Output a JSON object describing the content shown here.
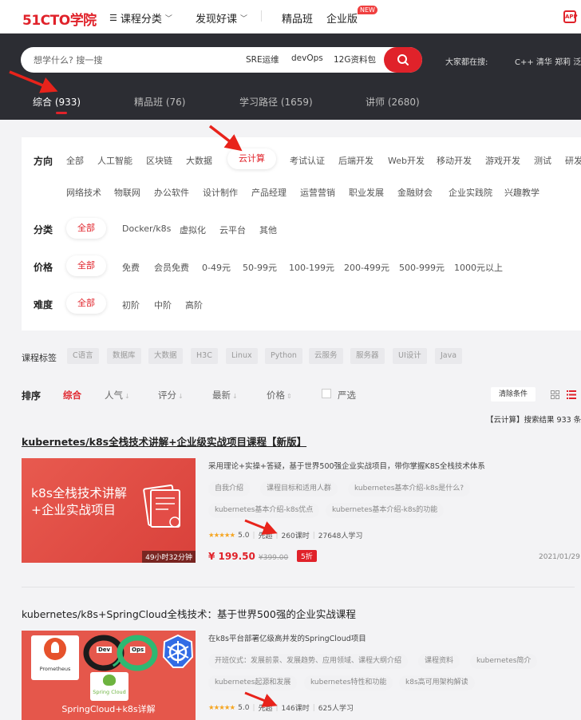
{
  "topnav": {
    "logo_main": "51CTO",
    "logo_suffix": "学院",
    "items": [
      {
        "label": "课程分类"
      },
      {
        "label": "发现好课"
      },
      {
        "label": "精品班"
      },
      {
        "label": "企业版"
      }
    ],
    "new_badge": "NEW",
    "app_icon_text": "APP"
  },
  "search": {
    "placeholder": "想学什么? 搜一搜",
    "hot_keywords": [
      "SRE运维",
      "devOps",
      "12G资料包"
    ],
    "right_label": "大家都在搜:",
    "right_terms": "C++ 清华 郑莉 泛"
  },
  "tabs": [
    {
      "label": "综合 (933)",
      "active": true
    },
    {
      "label": "精品班 (76)",
      "active": false
    },
    {
      "label": "学习路径 (1659)",
      "active": false
    },
    {
      "label": "讲师 (2680)",
      "active": false
    }
  ],
  "filters": {
    "direction": {
      "label": "方向",
      "row1": [
        "全部",
        "人工智能",
        "区块链",
        "大数据",
        "云计算",
        "考试认证",
        "后端开发",
        "Web开发",
        "移动开发",
        "游戏开发",
        "测试",
        "研发"
      ],
      "row2": [
        "网络技术",
        "物联网",
        "办公软件",
        "设计制作",
        "产品经理",
        "运营营销",
        "职业发展",
        "金融财会",
        "企业实践院",
        "兴趣教学"
      ],
      "selected": "云计算"
    },
    "category": {
      "label": "分类",
      "options": [
        "全部",
        "Docker/k8s",
        "虚拟化",
        "云平台",
        "其他"
      ],
      "selected": "全部"
    },
    "price": {
      "label": "价格",
      "options": [
        "全部",
        "免费",
        "会员免费",
        "0-49元",
        "50-99元",
        "100-199元",
        "200-499元",
        "500-999元",
        "1000元以上"
      ],
      "selected": "全部"
    },
    "level": {
      "label": "难度",
      "options": [
        "全部",
        "初阶",
        "中阶",
        "高阶"
      ],
      "selected": "全部"
    }
  },
  "course_tags": {
    "label": "课程标签",
    "tags": [
      "C语言",
      "数据库",
      "大数据",
      "H3C",
      "Linux",
      "Python",
      "云服务",
      "服务器",
      "UI设计",
      "Java"
    ]
  },
  "sort": {
    "label": "排序",
    "options": [
      "综合",
      "人气",
      "评分",
      "最新",
      "价格"
    ],
    "active": "综合",
    "strict_label": "严选",
    "clear_label": "清除条件"
  },
  "result_summary": "【云计算】搜索结果 933 条",
  "courses": [
    {
      "title": "kubernetes/k8s全栈技术讲解+企业级实战项目课程【新版】",
      "thumb_text": "k8s全栈技术讲解+企业实战项目",
      "duration": "49小时32分钟",
      "description": "采用理论+实操+答疑，基于世界500强企业实战项目，带你掌握K8S全栈技术体系",
      "chapters": [
        "自我介绍",
        "课程目标和适用人群",
        "kubernetes基本介绍-k8s是什么?",
        "kubernetes基本介绍-k8s优点",
        "kubernetes基本介绍-k8s的功能"
      ],
      "rating": "5.0",
      "level": "先超",
      "lessons": "260课时",
      "students": "27648人学习",
      "price": "¥ 199.50",
      "old_price": "¥399.00",
      "discount": "5折",
      "date": "2021/01/29"
    },
    {
      "title": "kubernetes/k8s+SpringCloud全栈技术：基于世界500强的企业实战课程",
      "thumb_labels": [
        "Prometheus",
        "Dev",
        "Ops",
        "Spring Cloud"
      ],
      "thumb_caption": "SpringCloud+k8s详解",
      "description": "在k8s平台部署亿级高并发的SpringCloud项目",
      "chapters": [
        "开班仪式：发展前景、发展趋势、应用领域、课程大纲介绍",
        "课程资料",
        "kubernetes简介",
        "kubernetes起源和发展",
        "kubernetes特性和功能",
        "k8s高可用架构解读"
      ],
      "rating": "5.0",
      "level": "先超",
      "lessons": "146课时",
      "students": "625人学习"
    }
  ],
  "colors": {
    "brand_red": "#e0222a",
    "dark_band": "#2c2d33",
    "page_bg": "#f3f3f5",
    "star": "#f5a623"
  }
}
